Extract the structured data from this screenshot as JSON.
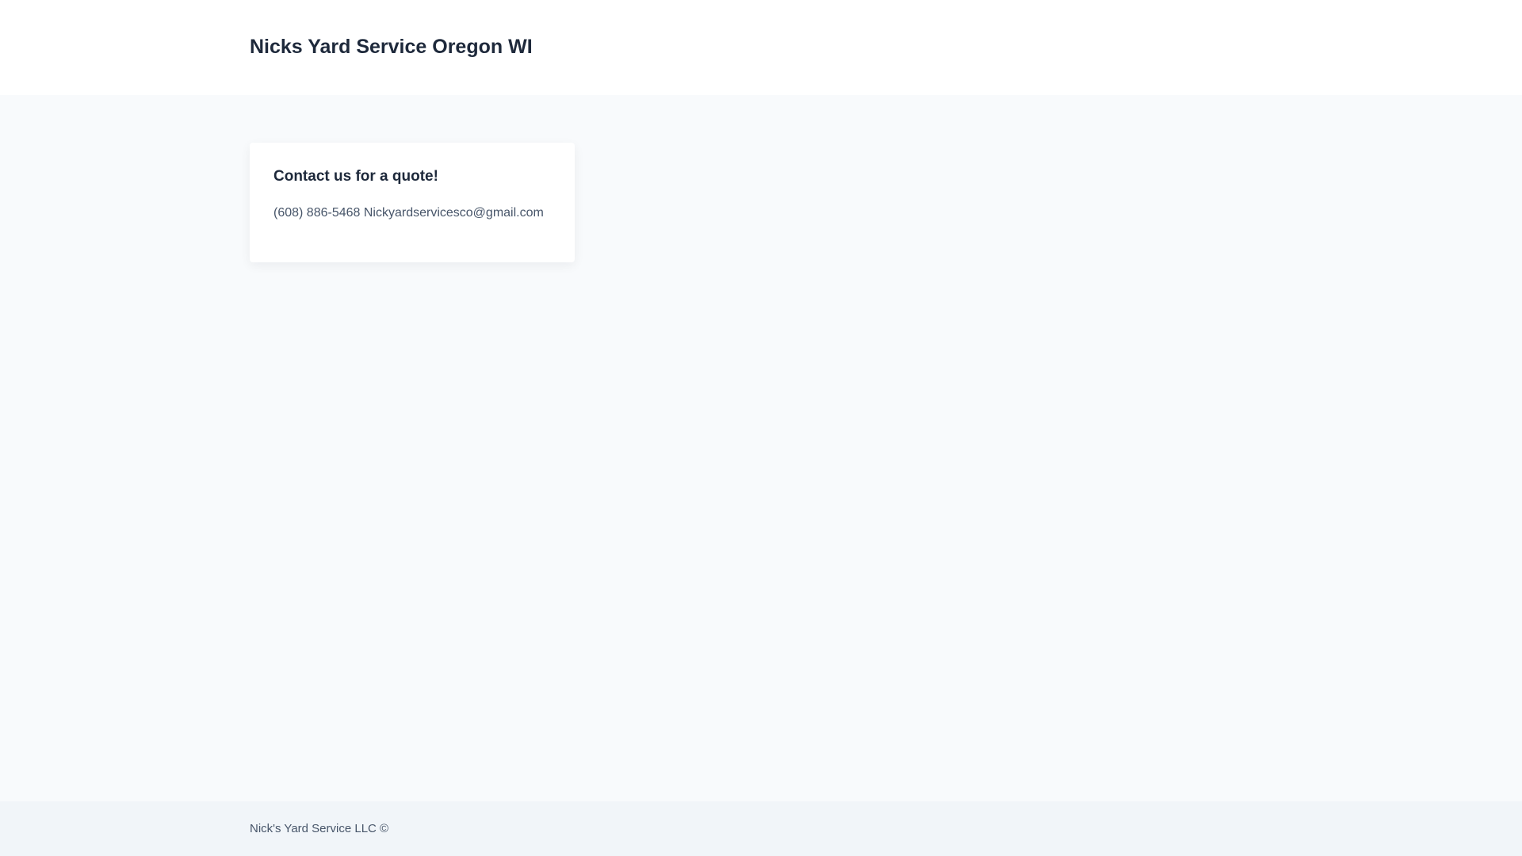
{
  "header": {
    "title": "Nicks Yard Service Oregon WI"
  },
  "contact_card": {
    "heading": "Contact us for a quote!",
    "details": "(608) 886-5468 Nickyardservicesco@gmail.com"
  },
  "footer": {
    "copyright": "Nick's Yard Service LLC ©"
  },
  "colors": {
    "page_background": "#f8fafc",
    "header_background": "#ffffff",
    "card_background": "#ffffff",
    "footer_background": "#f1f5f9",
    "heading_text": "#1e293b",
    "body_text": "#475569"
  }
}
